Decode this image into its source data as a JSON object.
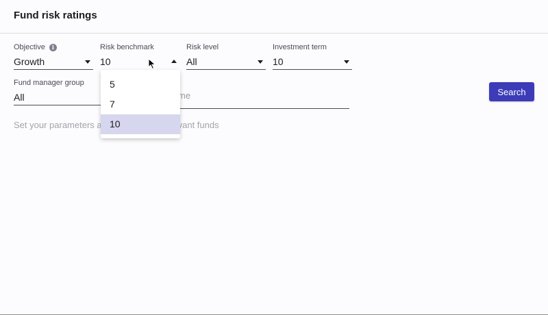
{
  "header": {
    "title": "Fund risk ratings"
  },
  "filters": {
    "objective": {
      "label": "Objective",
      "value": "Growth",
      "info_icon": "info-icon"
    },
    "risk_benchmark": {
      "label": "Risk benchmark",
      "value": "10"
    },
    "risk_level": {
      "label": "Risk level",
      "value": "All"
    },
    "investment_term": {
      "label": "Investment term",
      "value": "10"
    },
    "fund_manager_group": {
      "label": "Fund manager group",
      "value": "All"
    },
    "fund_name": {
      "placeholder_visible": "me"
    }
  },
  "search_button": {
    "label": "Search"
  },
  "hint": {
    "left": "Set your parameters a",
    "right": "vant funds"
  },
  "risk_benchmark_dropdown": {
    "options": [
      "5",
      "7",
      "10"
    ],
    "selected": "10"
  },
  "colors": {
    "accent": "#3c3cb8",
    "selected_option": "#d6d6ee",
    "hint_text": "#a3a3ab"
  }
}
